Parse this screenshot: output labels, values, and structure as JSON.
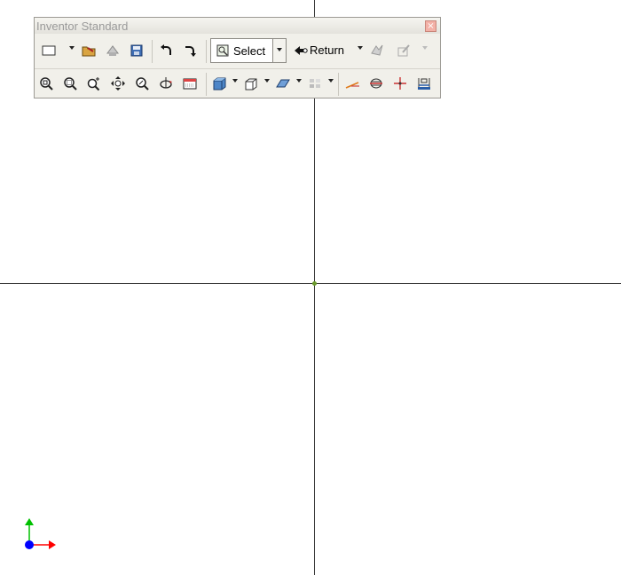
{
  "toolbar": {
    "title": "Inventor Standard",
    "select_label": "Select",
    "return_label": "Return"
  },
  "icons": {
    "row1": [
      "new-icon",
      "open-icon",
      "project-icon",
      "save-icon",
      "undo-icon",
      "redo-icon",
      "select-icon",
      "return-icon",
      "update-icon",
      "sketch-icon"
    ],
    "row2": [
      "zoom-all-icon",
      "zoom-window-icon",
      "zoom-icon",
      "pan-icon",
      "zoom-selected-icon",
      "rotate-icon",
      "look-at-icon",
      "shaded-display-icon",
      "camera-view-icon",
      "work-plane-icon",
      "visibility-icon",
      "work-axis-icon",
      "work-point-icon",
      "ucs-icon",
      "dimension-icon"
    ]
  },
  "colors": {
    "axis_line": "#3a3a3a",
    "x_axis": "#ff0000",
    "y_axis": "#00c000",
    "z_axis": "#0000ff"
  }
}
